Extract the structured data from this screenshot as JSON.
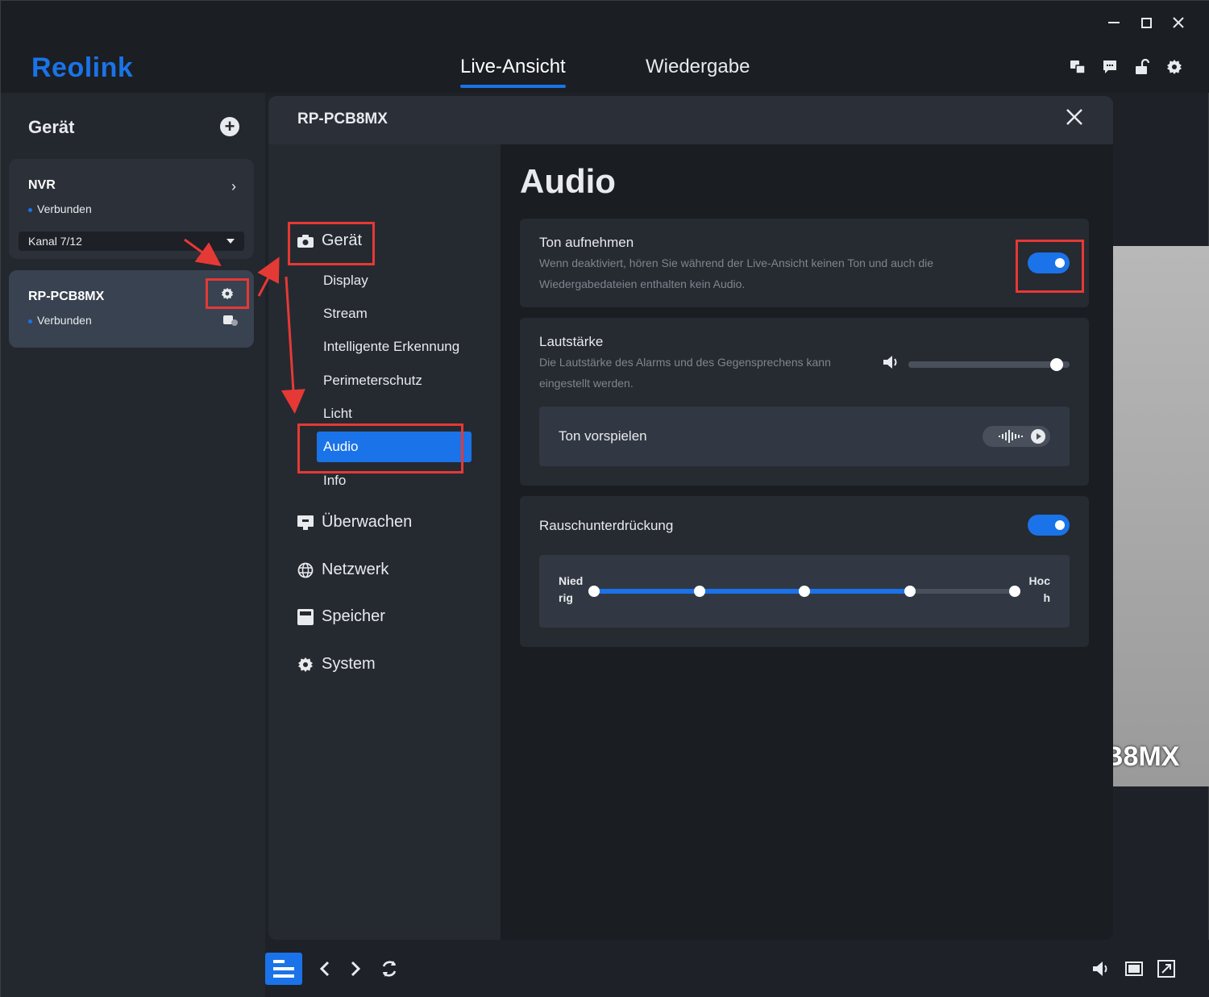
{
  "app": {
    "logo": "Reolink",
    "tabs": [
      {
        "label": "Live-Ansicht",
        "active": true
      },
      {
        "label": "Wiedergabe",
        "active": false
      }
    ],
    "window_controls": [
      "minimize-icon",
      "maximize-icon",
      "close-icon"
    ],
    "top_icons": [
      "translate-icon",
      "message-icon",
      "unlock-icon",
      "gear-icon"
    ]
  },
  "device_panel": {
    "title": "Gerät",
    "devices": [
      {
        "name": "NVR",
        "status": "Verbunden",
        "channel": "Kanal 7/12"
      },
      {
        "name": "RP-PCB8MX",
        "status": "Verbunden"
      }
    ]
  },
  "preview": {
    "overlay_text": "B8MX"
  },
  "modal": {
    "title": "RP-PCB8MX",
    "menu": {
      "groups": [
        {
          "label": "Gerät",
          "icon": "camera-icon"
        },
        {
          "label": "Überwachen",
          "icon": "monitor-icon"
        },
        {
          "label": "Netzwerk",
          "icon": "globe-icon"
        },
        {
          "label": "Speicher",
          "icon": "storage-icon"
        },
        {
          "label": "System",
          "icon": "gear-icon"
        }
      ],
      "device_items": [
        "Display",
        "Stream",
        "Intelligente Erkennung",
        "Perimeterschutz",
        "Licht",
        "Audio",
        "Info"
      ],
      "active_item": "Audio"
    },
    "content": {
      "page_title": "Audio",
      "record_audio": {
        "title": "Ton aufnehmen",
        "description": "Wenn deaktiviert, hören Sie während der Live-Ansicht keinen Ton und auch die Wiedergabedateien enthalten kein Audio.",
        "enabled": true
      },
      "volume": {
        "title": "Lautstärke",
        "description": "Die Lautstärke des Alarms und des Gegensprechens kann eingestellt werden.",
        "level_percent": 92
      },
      "play_sound": {
        "label": "Ton vorspielen"
      },
      "noise_reduction": {
        "title": "Rauschunterdrückung",
        "enabled": true,
        "low_label": "Nied rig",
        "high_label": "Hoc h",
        "steps": 5,
        "level_step": 4
      }
    }
  },
  "colors": {
    "accent": "#1a73e8",
    "highlight_box": "#e53935",
    "background": "#1e2128",
    "panel": "#262a31"
  }
}
